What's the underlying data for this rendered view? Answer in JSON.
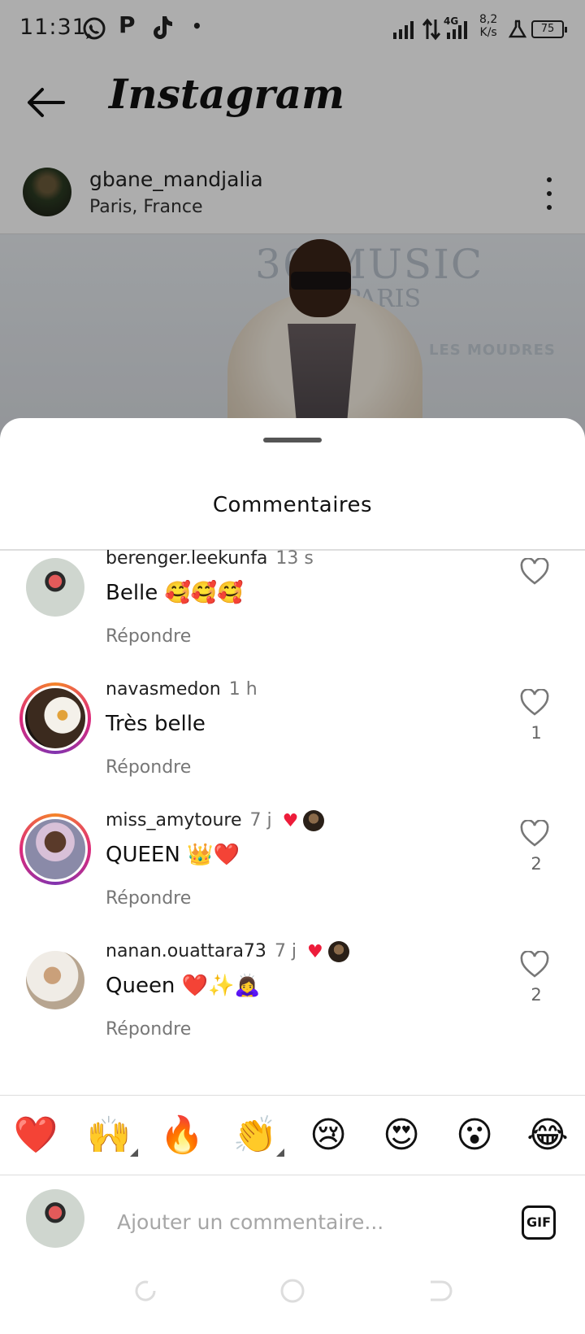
{
  "status_bar": {
    "time": "11:31",
    "net_speed_value": "8,2",
    "net_speed_unit": "K/s",
    "network_type": "4G",
    "battery": "75",
    "icons": [
      "whatsapp-icon",
      "p-icon",
      "tiktok-icon",
      "dot-icon",
      "signal-icon",
      "data-arrows-icon",
      "signal-4g-icon",
      "flask-icon",
      "battery-icon"
    ]
  },
  "app_header": {
    "title": "Instagram"
  },
  "post": {
    "username": "gbane_mandjalia",
    "location": "Paris, France",
    "image_text": [
      "36 MUSIC",
      "PARIS",
      "LES  MOUDRES"
    ]
  },
  "comments_sheet": {
    "title": "Commentaires",
    "comments": [
      {
        "username": "berenger.leekunfa",
        "time": "13 s",
        "text": "Belle 🥰🥰🥰",
        "reply": "Répondre",
        "likes": ""
      },
      {
        "username": "navasmedon",
        "time": "1 h",
        "text": "Très belle",
        "reply": "Répondre",
        "likes": "1"
      },
      {
        "username": "miss_amytoure",
        "time": "7 j",
        "text": "QUEEN 👑❤️",
        "reply": "Répondre",
        "likes": "2",
        "liked_by_author": true
      },
      {
        "username": "nanan.ouattara73",
        "time": "7 j",
        "text": "Queen ❤️✨🙇‍♀️",
        "reply": "Répondre",
        "likes": "2",
        "liked_by_author": true
      }
    ],
    "quick_reactions": [
      "❤️",
      "🙌",
      "🔥",
      "👏",
      "😢",
      "😍",
      "😮",
      "😂"
    ],
    "composer": {
      "placeholder": "Ajouter un commentaire...",
      "gif_label": "GIF"
    }
  },
  "colors": {
    "heart_red": "#ed1c3a",
    "muted_text": "#777777",
    "story_ring": [
      "#f58529",
      "#dd2a7b",
      "#8134af"
    ]
  }
}
